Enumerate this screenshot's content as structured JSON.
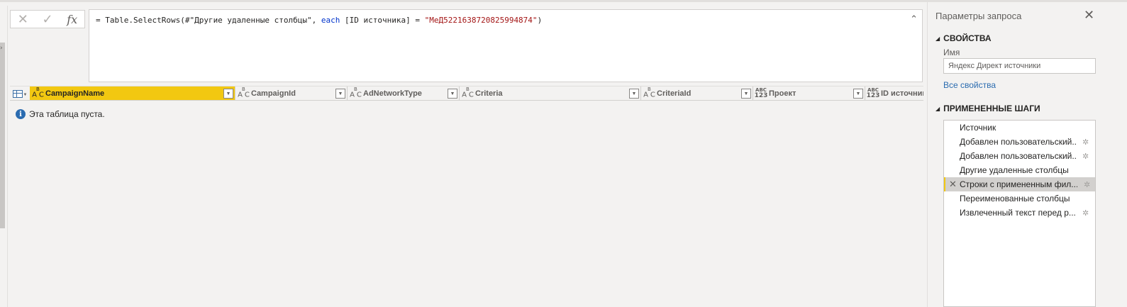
{
  "formula_bar": {
    "cancel_icon": "close-icon",
    "confirm_icon": "check-icon",
    "fx_label": "fx",
    "formula_prefix": "= Table.SelectRows(#\"Другие удаленные столбцы\", ",
    "formula_keyword": "each",
    "formula_middle": " [ID источника] = ",
    "formula_string": "\"МеД5221638720825994874\"",
    "formula_suffix": ")"
  },
  "grid": {
    "columns": [
      {
        "name": "CampaignName",
        "type": "ABC"
      },
      {
        "name": "CampaignId",
        "type": "ABC"
      },
      {
        "name": "AdNetworkType",
        "type": "ABC"
      },
      {
        "name": "Criteria",
        "type": "ABC"
      },
      {
        "name": "CriteriaId",
        "type": "ABC"
      },
      {
        "name": "Проект",
        "type": "ABC123"
      },
      {
        "name": "ID источника",
        "type": "ABC123"
      }
    ],
    "empty_message": "Эта таблица пуста."
  },
  "query_settings": {
    "title": "Параметры запроса",
    "properties_header": "СВОЙСТВА",
    "name_label": "Имя",
    "name_value": "Яндекс Директ источники",
    "all_properties_link": "Все свойства",
    "applied_steps_header": "ПРИМЕНЕННЫЕ ШАГИ",
    "steps": [
      {
        "label": "Источник",
        "has_settings": false,
        "active": false
      },
      {
        "label": "Добавлен пользовательский...",
        "has_settings": true,
        "active": false
      },
      {
        "label": "Добавлен пользовательский...",
        "has_settings": true,
        "active": false
      },
      {
        "label": "Другие удаленные столбцы",
        "has_settings": false,
        "active": false
      },
      {
        "label": "Строки с примененным фил...",
        "has_settings": true,
        "active": true
      },
      {
        "label": "Переименованные столбцы",
        "has_settings": false,
        "active": false
      },
      {
        "label": "Извлеченный текст перед р...",
        "has_settings": true,
        "active": false
      }
    ]
  },
  "colors": {
    "accent": "#f2c811",
    "link": "#2b6cb0",
    "keyword": "#0033cc",
    "string": "#a31515"
  }
}
